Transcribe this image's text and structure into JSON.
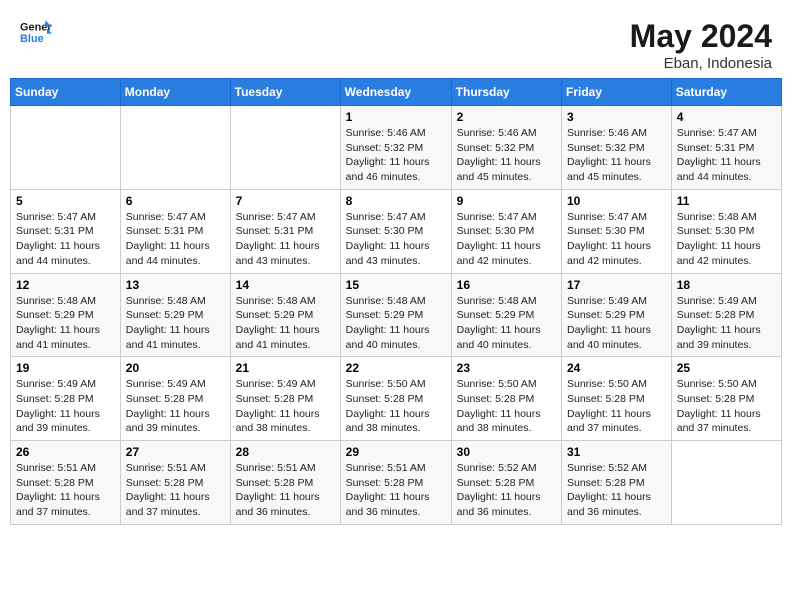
{
  "header": {
    "logo_general": "General",
    "logo_blue": "Blue",
    "month": "May 2024",
    "location": "Eban, Indonesia"
  },
  "weekdays": [
    "Sunday",
    "Monday",
    "Tuesday",
    "Wednesday",
    "Thursday",
    "Friday",
    "Saturday"
  ],
  "weeks": [
    [
      {
        "day": "",
        "sunrise": "",
        "sunset": "",
        "daylight": ""
      },
      {
        "day": "",
        "sunrise": "",
        "sunset": "",
        "daylight": ""
      },
      {
        "day": "",
        "sunrise": "",
        "sunset": "",
        "daylight": ""
      },
      {
        "day": "1",
        "sunrise": "Sunrise: 5:46 AM",
        "sunset": "Sunset: 5:32 PM",
        "daylight": "Daylight: 11 hours and 46 minutes."
      },
      {
        "day": "2",
        "sunrise": "Sunrise: 5:46 AM",
        "sunset": "Sunset: 5:32 PM",
        "daylight": "Daylight: 11 hours and 45 minutes."
      },
      {
        "day": "3",
        "sunrise": "Sunrise: 5:46 AM",
        "sunset": "Sunset: 5:32 PM",
        "daylight": "Daylight: 11 hours and 45 minutes."
      },
      {
        "day": "4",
        "sunrise": "Sunrise: 5:47 AM",
        "sunset": "Sunset: 5:31 PM",
        "daylight": "Daylight: 11 hours and 44 minutes."
      }
    ],
    [
      {
        "day": "5",
        "sunrise": "Sunrise: 5:47 AM",
        "sunset": "Sunset: 5:31 PM",
        "daylight": "Daylight: 11 hours and 44 minutes."
      },
      {
        "day": "6",
        "sunrise": "Sunrise: 5:47 AM",
        "sunset": "Sunset: 5:31 PM",
        "daylight": "Daylight: 11 hours and 44 minutes."
      },
      {
        "day": "7",
        "sunrise": "Sunrise: 5:47 AM",
        "sunset": "Sunset: 5:31 PM",
        "daylight": "Daylight: 11 hours and 43 minutes."
      },
      {
        "day": "8",
        "sunrise": "Sunrise: 5:47 AM",
        "sunset": "Sunset: 5:30 PM",
        "daylight": "Daylight: 11 hours and 43 minutes."
      },
      {
        "day": "9",
        "sunrise": "Sunrise: 5:47 AM",
        "sunset": "Sunset: 5:30 PM",
        "daylight": "Daylight: 11 hours and 42 minutes."
      },
      {
        "day": "10",
        "sunrise": "Sunrise: 5:47 AM",
        "sunset": "Sunset: 5:30 PM",
        "daylight": "Daylight: 11 hours and 42 minutes."
      },
      {
        "day": "11",
        "sunrise": "Sunrise: 5:48 AM",
        "sunset": "Sunset: 5:30 PM",
        "daylight": "Daylight: 11 hours and 42 minutes."
      }
    ],
    [
      {
        "day": "12",
        "sunrise": "Sunrise: 5:48 AM",
        "sunset": "Sunset: 5:29 PM",
        "daylight": "Daylight: 11 hours and 41 minutes."
      },
      {
        "day": "13",
        "sunrise": "Sunrise: 5:48 AM",
        "sunset": "Sunset: 5:29 PM",
        "daylight": "Daylight: 11 hours and 41 minutes."
      },
      {
        "day": "14",
        "sunrise": "Sunrise: 5:48 AM",
        "sunset": "Sunset: 5:29 PM",
        "daylight": "Daylight: 11 hours and 41 minutes."
      },
      {
        "day": "15",
        "sunrise": "Sunrise: 5:48 AM",
        "sunset": "Sunset: 5:29 PM",
        "daylight": "Daylight: 11 hours and 40 minutes."
      },
      {
        "day": "16",
        "sunrise": "Sunrise: 5:48 AM",
        "sunset": "Sunset: 5:29 PM",
        "daylight": "Daylight: 11 hours and 40 minutes."
      },
      {
        "day": "17",
        "sunrise": "Sunrise: 5:49 AM",
        "sunset": "Sunset: 5:29 PM",
        "daylight": "Daylight: 11 hours and 40 minutes."
      },
      {
        "day": "18",
        "sunrise": "Sunrise: 5:49 AM",
        "sunset": "Sunset: 5:28 PM",
        "daylight": "Daylight: 11 hours and 39 minutes."
      }
    ],
    [
      {
        "day": "19",
        "sunrise": "Sunrise: 5:49 AM",
        "sunset": "Sunset: 5:28 PM",
        "daylight": "Daylight: 11 hours and 39 minutes."
      },
      {
        "day": "20",
        "sunrise": "Sunrise: 5:49 AM",
        "sunset": "Sunset: 5:28 PM",
        "daylight": "Daylight: 11 hours and 39 minutes."
      },
      {
        "day": "21",
        "sunrise": "Sunrise: 5:49 AM",
        "sunset": "Sunset: 5:28 PM",
        "daylight": "Daylight: 11 hours and 38 minutes."
      },
      {
        "day": "22",
        "sunrise": "Sunrise: 5:50 AM",
        "sunset": "Sunset: 5:28 PM",
        "daylight": "Daylight: 11 hours and 38 minutes."
      },
      {
        "day": "23",
        "sunrise": "Sunrise: 5:50 AM",
        "sunset": "Sunset: 5:28 PM",
        "daylight": "Daylight: 11 hours and 38 minutes."
      },
      {
        "day": "24",
        "sunrise": "Sunrise: 5:50 AM",
        "sunset": "Sunset: 5:28 PM",
        "daylight": "Daylight: 11 hours and 37 minutes."
      },
      {
        "day": "25",
        "sunrise": "Sunrise: 5:50 AM",
        "sunset": "Sunset: 5:28 PM",
        "daylight": "Daylight: 11 hours and 37 minutes."
      }
    ],
    [
      {
        "day": "26",
        "sunrise": "Sunrise: 5:51 AM",
        "sunset": "Sunset: 5:28 PM",
        "daylight": "Daylight: 11 hours and 37 minutes."
      },
      {
        "day": "27",
        "sunrise": "Sunrise: 5:51 AM",
        "sunset": "Sunset: 5:28 PM",
        "daylight": "Daylight: 11 hours and 37 minutes."
      },
      {
        "day": "28",
        "sunrise": "Sunrise: 5:51 AM",
        "sunset": "Sunset: 5:28 PM",
        "daylight": "Daylight: 11 hours and 36 minutes."
      },
      {
        "day": "29",
        "sunrise": "Sunrise: 5:51 AM",
        "sunset": "Sunset: 5:28 PM",
        "daylight": "Daylight: 11 hours and 36 minutes."
      },
      {
        "day": "30",
        "sunrise": "Sunrise: 5:52 AM",
        "sunset": "Sunset: 5:28 PM",
        "daylight": "Daylight: 11 hours and 36 minutes."
      },
      {
        "day": "31",
        "sunrise": "Sunrise: 5:52 AM",
        "sunset": "Sunset: 5:28 PM",
        "daylight": "Daylight: 11 hours and 36 minutes."
      },
      {
        "day": "",
        "sunrise": "",
        "sunset": "",
        "daylight": ""
      }
    ]
  ]
}
